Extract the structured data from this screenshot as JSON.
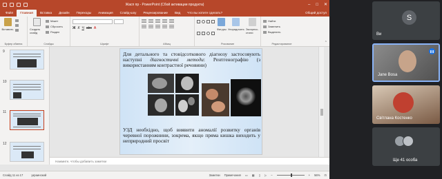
{
  "window": {
    "title": "Жасп пр - PowerPoint (Сбой активации продукта)"
  },
  "tabs": [
    "Файл",
    "Главная",
    "Вставка",
    "Дизайн",
    "Переходы",
    "Анимация",
    "Слайд-шоу",
    "Рецензирование",
    "Вид",
    "Что вы хотите сделать?"
  ],
  "share_label": "Общий доступ",
  "ribbon": {
    "paste": "Вставить",
    "new_slide": "Создать слайд",
    "layout": "Макет",
    "reset": "Сбросить",
    "section": "Раздел",
    "shapes": "Фигуры",
    "arrange": "Упорядочить",
    "quick_styles": "Экспресс-стили",
    "find": "Найти",
    "replace": "Заменить",
    "select": "Выделить",
    "groups": {
      "clipboard": "Буфер обмена",
      "slides": "Слайды",
      "font": "Шрифт",
      "paragraph": "Абзац",
      "drawing": "Рисование",
      "editing": "Редактирование"
    }
  },
  "thumbnails": [
    {
      "number": "9"
    },
    {
      "number": "10"
    },
    {
      "number": "11"
    },
    {
      "number": "12"
    }
  ],
  "slide": {
    "text_top_1": "Для детального та стовідсоткового діагнозу застосовують наступні ",
    "text_top_italic": "діагностичні методи",
    "text_top_2": ": Рентгенографію (з використанням контрастної речовини)",
    "text_bottom": "УЗД необхідно, щоб виявити аномалії розвитку органів черевної порожнини, зокрема, якщо пряма кишка виходить у неприродний просвіт"
  },
  "notes_placeholder": "Нажмите, чтобы добавить заметки",
  "status": {
    "slide_counter": "Слайд 11 из 17",
    "language": "украинский",
    "notes_label": "Заметки",
    "comments_label": "Примечания",
    "zoom": "56%"
  },
  "participants": [
    {
      "name": "Ви",
      "initial": "S"
    },
    {
      "name": "Jane Bosa"
    },
    {
      "name": "Світлана Костенко"
    },
    {
      "name": "Ще 41 особа"
    }
  ],
  "colors": {
    "ppt_accent": "#b7472a",
    "meet_bg": "#202124",
    "tile_bg": "#3c4043",
    "active_border": "#8ab4f8"
  }
}
